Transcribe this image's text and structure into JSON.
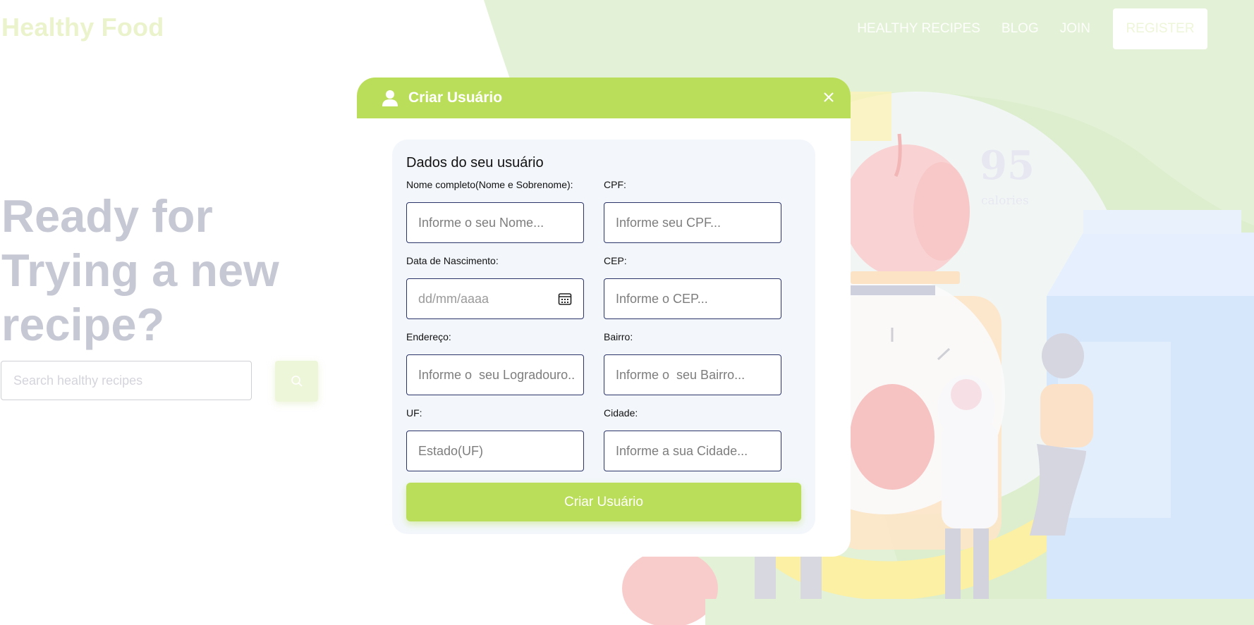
{
  "site": {
    "logo": "Healthy Food",
    "nav": [
      "HEALTHY RECIPES",
      "BLOG",
      "JOIN"
    ],
    "register": "REGISTER"
  },
  "hero": {
    "title": "Ready for Trying a new recipe?",
    "search_placeholder": "Search healthy recipes"
  },
  "illustration": {
    "calories_value": "95",
    "calories_label": "calories"
  },
  "modal": {
    "title": "Criar Usuário",
    "section_title": "Dados do seu usuário",
    "fields": {
      "nome": {
        "label": "Nome completo(Nome e Sobrenome):",
        "placeholder": "Informe o seu Nome..."
      },
      "cpf": {
        "label": "CPF:",
        "placeholder": "Informe seu CPF..."
      },
      "nascimento": {
        "label": "Data de Nascimento:",
        "placeholder": "dd/mm/aaaa"
      },
      "cep": {
        "label": "CEP:",
        "placeholder": "Informe o CEP..."
      },
      "endereco": {
        "label": "Endereço:",
        "placeholder": "Informe o  seu Logradouro.."
      },
      "bairro": {
        "label": "Bairro:",
        "placeholder": "Informe o  seu Bairro..."
      },
      "uf": {
        "label": "UF:",
        "placeholder": "Estado(UF)"
      },
      "cidade": {
        "label": "Cidade:",
        "placeholder": "Informe a sua Cidade..."
      }
    },
    "submit": "Criar Usuário"
  },
  "colors": {
    "accent": "#bade59",
    "input_border": "#2a3468",
    "card_bg": "#f3f7fb"
  },
  "icons": [
    "user-icon",
    "close-icon",
    "calendar-icon",
    "search-icon"
  ]
}
